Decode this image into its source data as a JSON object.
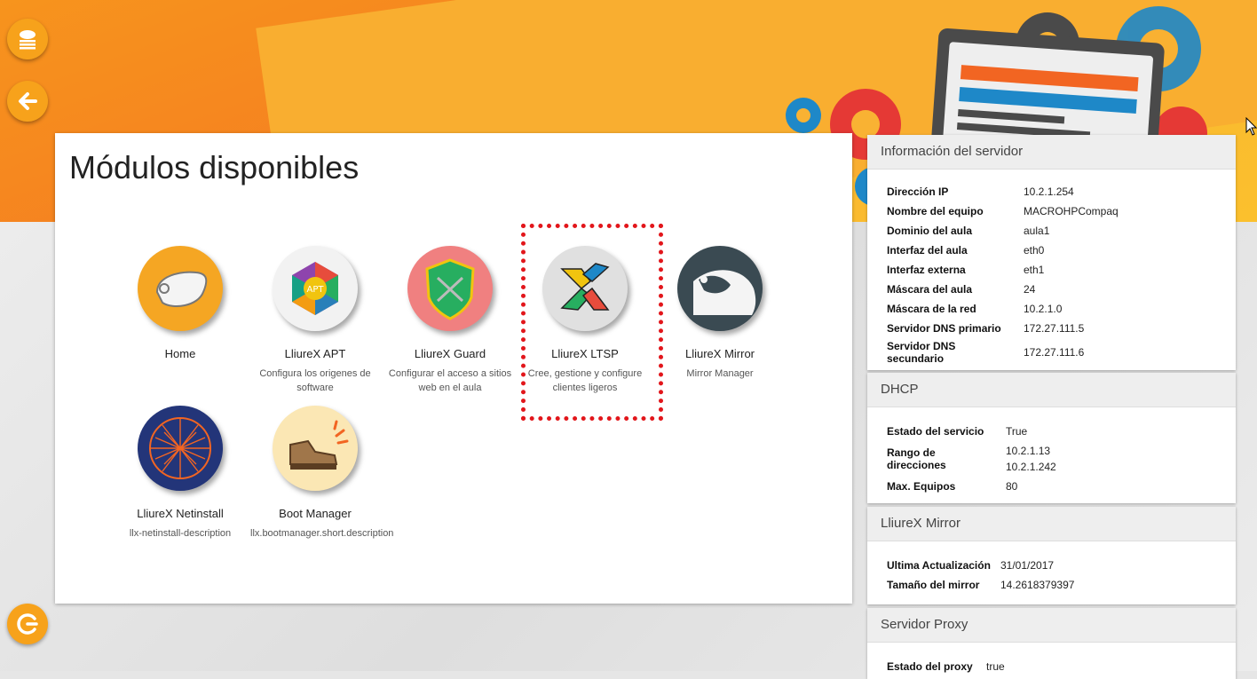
{
  "main": {
    "title": "Módulos disponibles",
    "modules": [
      {
        "name": "Home",
        "description": "",
        "icon": "home-mouse-icon"
      },
      {
        "name": "LliureX APT",
        "description": "Configura los origenes de software",
        "icon": "apt-hexagon-icon"
      },
      {
        "name": "LliureX Guard",
        "description": "Configurar el acceso a sitios web en el aula",
        "icon": "guard-shield-icon"
      },
      {
        "name": "LliureX LTSP",
        "description": "Cree, gestione y configure clientes ligeros",
        "icon": "ltsp-x-icon"
      },
      {
        "name": "LliureX Mirror",
        "description": "Mirror Manager",
        "icon": "mirror-mouse-icon"
      },
      {
        "name": "LliureX Netinstall",
        "description": "llx-netinstall-description",
        "icon": "netinstall-network-icon"
      },
      {
        "name": "Boot Manager",
        "description": "llx.bootmanager.short.description",
        "icon": "boot-shoe-icon"
      }
    ]
  },
  "server_info": {
    "title": "Información del servidor",
    "rows": [
      {
        "key": "Dirección IP",
        "value": "10.2.1.254"
      },
      {
        "key": "Nombre del equipo",
        "value": "MACROHPCompaq"
      },
      {
        "key": "Dominio del aula",
        "value": "aula1"
      },
      {
        "key": "Interfaz del aula",
        "value": "eth0"
      },
      {
        "key": "Interfaz externa",
        "value": "eth1"
      },
      {
        "key": "Máscara del aula",
        "value": "24"
      },
      {
        "key": "Máscara de la red",
        "value": "10.2.1.0"
      },
      {
        "key": "Servidor DNS primario",
        "value": "172.27.111.5"
      },
      {
        "key": "Servidor DNS secundario",
        "value": "172.27.111.6"
      }
    ]
  },
  "dhcp": {
    "title": "DHCP",
    "service_key": "Estado del servicio",
    "service_value": "True",
    "range_key": "Rango de direcciones",
    "range_start": "10.2.1.13",
    "range_end": "10.2.1.242",
    "max_key": "Max. Equipos",
    "max_value": "80"
  },
  "mirror": {
    "title": "LliureX Mirror",
    "rows": [
      {
        "key": "Ultima Actualización",
        "value": "31/01/2017"
      },
      {
        "key": "Tamaño del mirror",
        "value": "14.2618379397"
      }
    ]
  },
  "proxy": {
    "title": "Servidor Proxy",
    "rows": [
      {
        "key": "Estado del proxy",
        "value": "true"
      }
    ]
  },
  "colors": {
    "accent": "#f7a21b",
    "highlight": "#e2161b"
  }
}
